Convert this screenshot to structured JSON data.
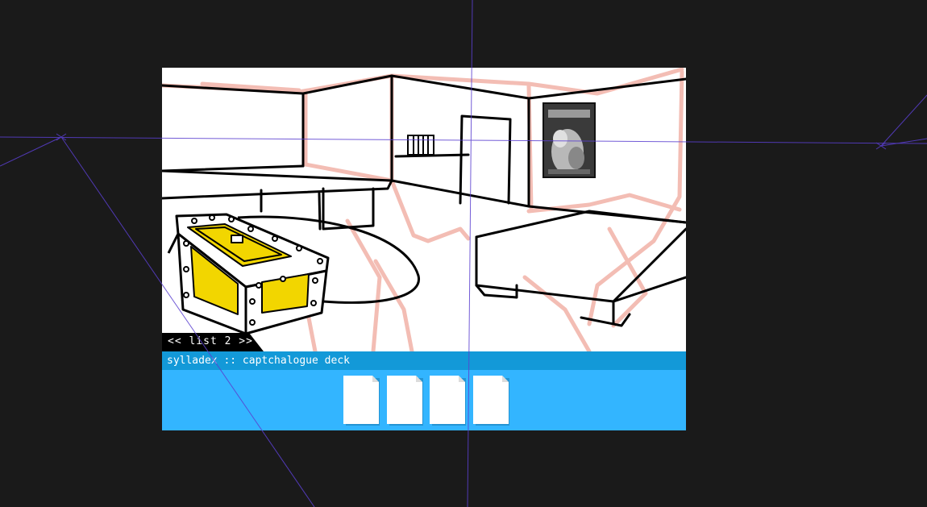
{
  "viewer": {
    "list_nav_label": "<< list 2 >>"
  },
  "sylladex": {
    "header": "sylladex :: captchalogue deck",
    "empty_card_count": 4,
    "cards": [
      {
        "name": "empty-card-1"
      },
      {
        "name": "empty-card-2"
      },
      {
        "name": "empty-card-3"
      },
      {
        "name": "empty-card-4"
      }
    ]
  },
  "colors": {
    "background": "#1a1a1a",
    "sylladex_body": "#33b5ff",
    "sylladex_header": "#1399d8",
    "sketch_lines": "#f3bdb4",
    "chest_highlight": "#f2d600",
    "guide_lines": "#5a3fd0"
  },
  "scene": {
    "room": "bedroom",
    "poster_icon": "movie-poster-icon",
    "chest_icon": "treasure-chest-icon"
  }
}
